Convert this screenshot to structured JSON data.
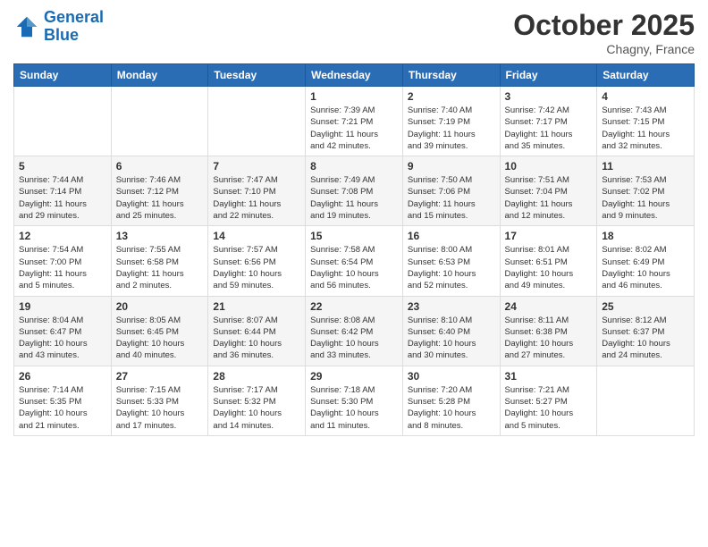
{
  "header": {
    "logo_line1": "General",
    "logo_line2": "Blue",
    "month": "October 2025",
    "location": "Chagny, France"
  },
  "weekdays": [
    "Sunday",
    "Monday",
    "Tuesday",
    "Wednesday",
    "Thursday",
    "Friday",
    "Saturday"
  ],
  "weeks": [
    [
      {
        "day": "",
        "info": ""
      },
      {
        "day": "",
        "info": ""
      },
      {
        "day": "",
        "info": ""
      },
      {
        "day": "1",
        "info": "Sunrise: 7:39 AM\nSunset: 7:21 PM\nDaylight: 11 hours\nand 42 minutes."
      },
      {
        "day": "2",
        "info": "Sunrise: 7:40 AM\nSunset: 7:19 PM\nDaylight: 11 hours\nand 39 minutes."
      },
      {
        "day": "3",
        "info": "Sunrise: 7:42 AM\nSunset: 7:17 PM\nDaylight: 11 hours\nand 35 minutes."
      },
      {
        "day": "4",
        "info": "Sunrise: 7:43 AM\nSunset: 7:15 PM\nDaylight: 11 hours\nand 32 minutes."
      }
    ],
    [
      {
        "day": "5",
        "info": "Sunrise: 7:44 AM\nSunset: 7:14 PM\nDaylight: 11 hours\nand 29 minutes."
      },
      {
        "day": "6",
        "info": "Sunrise: 7:46 AM\nSunset: 7:12 PM\nDaylight: 11 hours\nand 25 minutes."
      },
      {
        "day": "7",
        "info": "Sunrise: 7:47 AM\nSunset: 7:10 PM\nDaylight: 11 hours\nand 22 minutes."
      },
      {
        "day": "8",
        "info": "Sunrise: 7:49 AM\nSunset: 7:08 PM\nDaylight: 11 hours\nand 19 minutes."
      },
      {
        "day": "9",
        "info": "Sunrise: 7:50 AM\nSunset: 7:06 PM\nDaylight: 11 hours\nand 15 minutes."
      },
      {
        "day": "10",
        "info": "Sunrise: 7:51 AM\nSunset: 7:04 PM\nDaylight: 11 hours\nand 12 minutes."
      },
      {
        "day": "11",
        "info": "Sunrise: 7:53 AM\nSunset: 7:02 PM\nDaylight: 11 hours\nand 9 minutes."
      }
    ],
    [
      {
        "day": "12",
        "info": "Sunrise: 7:54 AM\nSunset: 7:00 PM\nDaylight: 11 hours\nand 5 minutes."
      },
      {
        "day": "13",
        "info": "Sunrise: 7:55 AM\nSunset: 6:58 PM\nDaylight: 11 hours\nand 2 minutes."
      },
      {
        "day": "14",
        "info": "Sunrise: 7:57 AM\nSunset: 6:56 PM\nDaylight: 10 hours\nand 59 minutes."
      },
      {
        "day": "15",
        "info": "Sunrise: 7:58 AM\nSunset: 6:54 PM\nDaylight: 10 hours\nand 56 minutes."
      },
      {
        "day": "16",
        "info": "Sunrise: 8:00 AM\nSunset: 6:53 PM\nDaylight: 10 hours\nand 52 minutes."
      },
      {
        "day": "17",
        "info": "Sunrise: 8:01 AM\nSunset: 6:51 PM\nDaylight: 10 hours\nand 49 minutes."
      },
      {
        "day": "18",
        "info": "Sunrise: 8:02 AM\nSunset: 6:49 PM\nDaylight: 10 hours\nand 46 minutes."
      }
    ],
    [
      {
        "day": "19",
        "info": "Sunrise: 8:04 AM\nSunset: 6:47 PM\nDaylight: 10 hours\nand 43 minutes."
      },
      {
        "day": "20",
        "info": "Sunrise: 8:05 AM\nSunset: 6:45 PM\nDaylight: 10 hours\nand 40 minutes."
      },
      {
        "day": "21",
        "info": "Sunrise: 8:07 AM\nSunset: 6:44 PM\nDaylight: 10 hours\nand 36 minutes."
      },
      {
        "day": "22",
        "info": "Sunrise: 8:08 AM\nSunset: 6:42 PM\nDaylight: 10 hours\nand 33 minutes."
      },
      {
        "day": "23",
        "info": "Sunrise: 8:10 AM\nSunset: 6:40 PM\nDaylight: 10 hours\nand 30 minutes."
      },
      {
        "day": "24",
        "info": "Sunrise: 8:11 AM\nSunset: 6:38 PM\nDaylight: 10 hours\nand 27 minutes."
      },
      {
        "day": "25",
        "info": "Sunrise: 8:12 AM\nSunset: 6:37 PM\nDaylight: 10 hours\nand 24 minutes."
      }
    ],
    [
      {
        "day": "26",
        "info": "Sunrise: 7:14 AM\nSunset: 5:35 PM\nDaylight: 10 hours\nand 21 minutes."
      },
      {
        "day": "27",
        "info": "Sunrise: 7:15 AM\nSunset: 5:33 PM\nDaylight: 10 hours\nand 17 minutes."
      },
      {
        "day": "28",
        "info": "Sunrise: 7:17 AM\nSunset: 5:32 PM\nDaylight: 10 hours\nand 14 minutes."
      },
      {
        "day": "29",
        "info": "Sunrise: 7:18 AM\nSunset: 5:30 PM\nDaylight: 10 hours\nand 11 minutes."
      },
      {
        "day": "30",
        "info": "Sunrise: 7:20 AM\nSunset: 5:28 PM\nDaylight: 10 hours\nand 8 minutes."
      },
      {
        "day": "31",
        "info": "Sunrise: 7:21 AM\nSunset: 5:27 PM\nDaylight: 10 hours\nand 5 minutes."
      },
      {
        "day": "",
        "info": ""
      }
    ]
  ]
}
